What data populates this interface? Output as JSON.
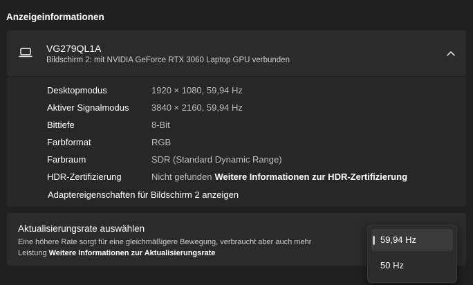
{
  "section": {
    "title": "Anzeigeinformationen"
  },
  "monitor": {
    "icon": "laptop-icon",
    "name": "VG279QL1A",
    "subtitle": "Bildschirm 2: mit NVIDIA GeForce RTX 3060 Laptop GPU verbunden",
    "expand_icon": "chevron-up-icon"
  },
  "details": [
    {
      "label": "Desktopmodus",
      "value": "1920 × 1080, 59,94 Hz"
    },
    {
      "label": "Aktiver Signalmodus",
      "value": "3840 × 2160, 59,94 Hz"
    },
    {
      "label": "Bittiefe",
      "value": "8-Bit"
    },
    {
      "label": "Farbformat",
      "value": "RGB"
    },
    {
      "label": "Farbraum",
      "value": "SDR (Standard Dynamic Range)"
    },
    {
      "label": "HDR-Zertifizierung",
      "value": "Nicht gefunden",
      "link": "Weitere Informationen zur HDR-Zertifizierung"
    }
  ],
  "adapter_link": "Adaptereigenschaften für Bildschirm 2 anzeigen",
  "refresh": {
    "title": "Aktualisierungsrate auswählen",
    "description": "Eine höhere Rate sorgt für eine gleichmäßigere Bewegung, verbraucht aber auch mehr Leistung",
    "link": "Weitere Informationen zur Aktualisierungsrate",
    "options": [
      "59,94 Hz",
      "50 Hz"
    ],
    "selected": "59,94 Hz"
  }
}
